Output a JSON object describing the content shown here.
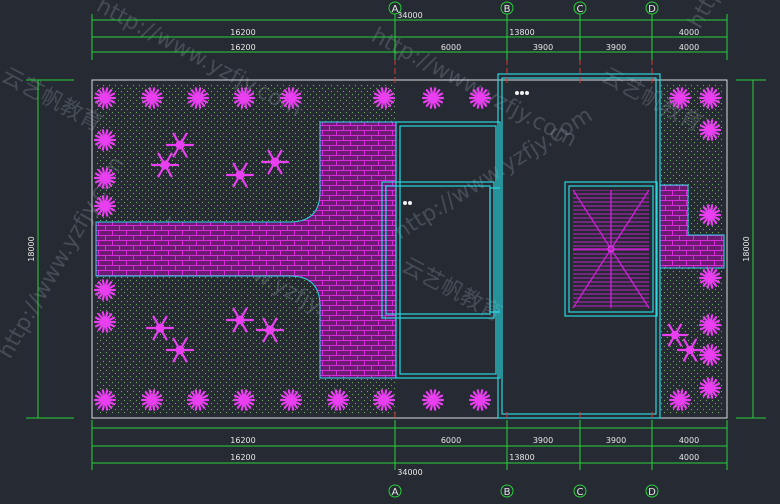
{
  "colors": {
    "background": "#252a33",
    "dimension_line": "#29d13a",
    "axis_line": "#d83a3a",
    "wall": "#29d7e0",
    "paving": "#c023c8",
    "flower": "#e93ff0",
    "lawn_dot": "#6fae5e",
    "text": "#e8e8e8"
  },
  "axes": {
    "top": [
      "A",
      "B",
      "C",
      "D"
    ],
    "bottom": [
      "A",
      "B",
      "C",
      "D"
    ]
  },
  "dimensions": {
    "top_total": "34000",
    "top_row2": [
      "16200",
      "13800",
      "4000"
    ],
    "top_row3": [
      "16200",
      "6000",
      "3900",
      "3900",
      "4000"
    ],
    "bottom_row1": [
      "16200",
      "6000",
      "3900",
      "3900",
      "4000"
    ],
    "bottom_row2": [
      "16200",
      "13800",
      "4000"
    ],
    "bottom_total": "34000",
    "left_height": "18000",
    "right_height": "18000"
  },
  "watermark": {
    "url_text": "http://www.yzfjy.com",
    "brand_text": "云艺帆教育"
  },
  "icons": [
    "flower-icon",
    "paving-pattern",
    "roof-hatch"
  ]
}
